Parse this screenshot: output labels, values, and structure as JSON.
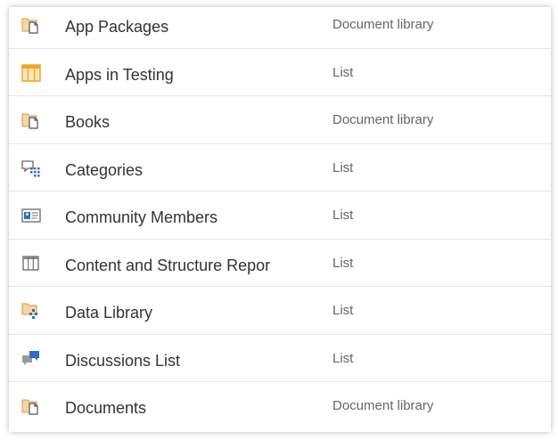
{
  "items": [
    {
      "name": "App Packages",
      "type": "Document library",
      "icon": "document-library-icon"
    },
    {
      "name": "Apps in Testing",
      "type": "List",
      "icon": "list-table-icon"
    },
    {
      "name": "Books",
      "type": "Document library",
      "icon": "document-library-icon"
    },
    {
      "name": "Categories",
      "type": "List",
      "icon": "categories-icon"
    },
    {
      "name": "Community Members",
      "type": "List",
      "icon": "contact-card-icon"
    },
    {
      "name": "Content and Structure Reports",
      "type": "List",
      "icon": "grid-list-icon"
    },
    {
      "name": "Data Library",
      "type": "List",
      "icon": "data-library-icon"
    },
    {
      "name": "Discussions List",
      "type": "List",
      "icon": "discussion-icon"
    },
    {
      "name": "Documents",
      "type": "Document library",
      "icon": "document-library-icon"
    }
  ],
  "colors": {
    "folder": "#e8b06a",
    "folder_light": "#f5d7a6",
    "accent_blue": "#2f6fbf",
    "icon_gray": "#7a7a7a",
    "table_orange": "#f2a623"
  }
}
